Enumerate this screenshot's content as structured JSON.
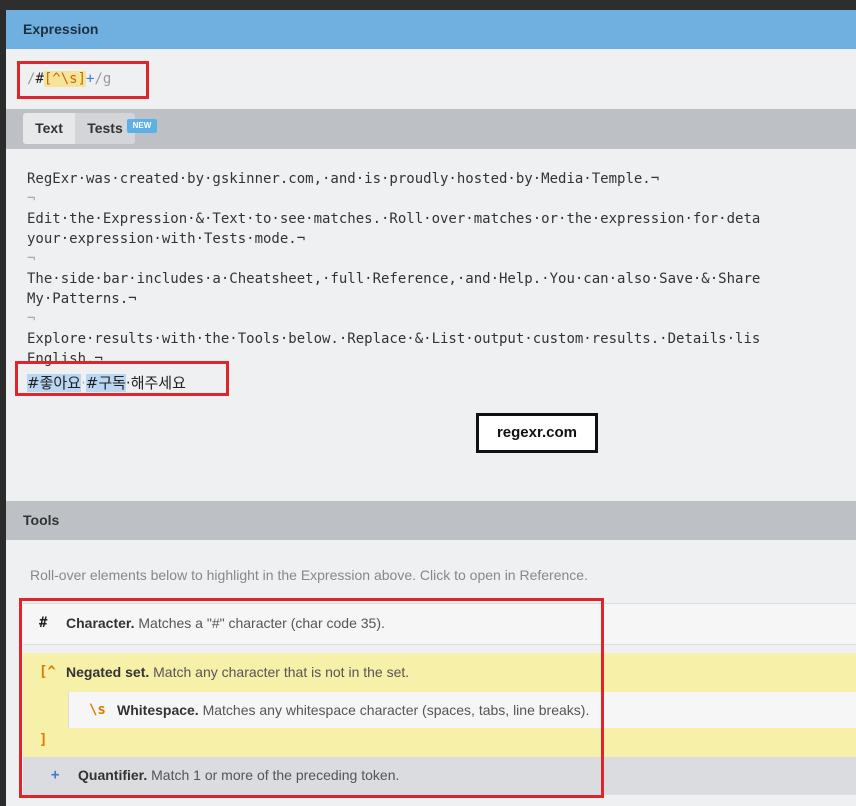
{
  "expression_panel": {
    "title": "Expression",
    "tokens": {
      "open_slash": "/",
      "hash": "#",
      "set_open": "[^",
      "set_inner": "\\s",
      "set_close": "]",
      "quantifier": "+",
      "close_slash": "/",
      "flags": "g"
    }
  },
  "tabs": {
    "text": "Text",
    "tests": "Tests",
    "tests_badge": "NEW"
  },
  "editor": {
    "lines": [
      "RegExr·was·created·by·gskinner.com,·and·is·proudly·hosted·by·Media·Temple.¬",
      "¬",
      "Edit·the·Expression·&·Text·to·see·matches.·Roll·over·matches·or·the·expression·for·deta",
      "your·expression·with·Tests·mode.¬",
      "¬",
      "The·side·bar·includes·a·Cheatsheet,·full·Reference,·and·Help.·You·can·also·Save·&·Share",
      "My·Patterns.¬",
      "¬",
      "Explore·results·with·the·Tools·below.·Replace·&·List·output·custom·results.·Details·lis",
      "English.¬"
    ],
    "korean": {
      "match1": "#좋아요",
      "sep1": "·",
      "match2": "#구독",
      "rest": "·해주세요"
    },
    "overlay_label": "regexr.com"
  },
  "tools": {
    "title": "Tools",
    "hint": "Roll-over elements below to highlight in the Expression above. Click to open in Reference.",
    "items": [
      {
        "token": "#",
        "name": "Character.",
        "desc": " Matches a \"#\" character (char code 35)."
      },
      {
        "token": "[^",
        "name": "Negated set.",
        "desc": " Match any character that is not in the set."
      },
      {
        "token": "\\s",
        "name": "Whitespace.",
        "desc": " Matches any whitespace character (spaces, tabs, line breaks)."
      },
      {
        "token": "]",
        "name": "",
        "desc": ""
      },
      {
        "token": "+",
        "name": "Quantifier.",
        "desc": " Match 1 or more of the preceding token."
      }
    ]
  },
  "colors": {
    "header_blue": "#6fb0e0",
    "highlight_red": "#e0242c",
    "set_yellow": "#f7f0a8",
    "match_blue": "#b9d6f2"
  }
}
